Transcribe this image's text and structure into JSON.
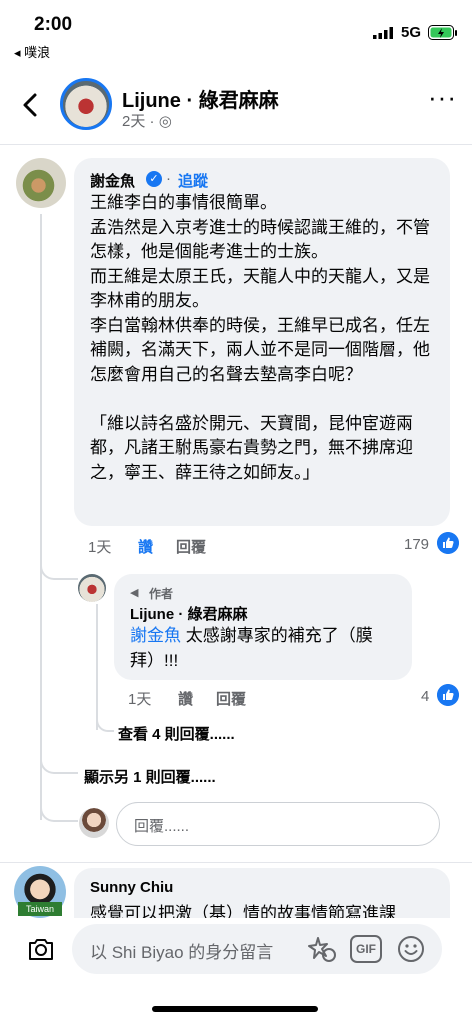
{
  "status_bar": {
    "time": "2:00",
    "back_app": "◂ 噗浪",
    "network": "5G",
    "battery_color": "#34c759"
  },
  "header": {
    "title": "Lijune · 綠君麻麻",
    "meta": "2天 · ",
    "back_icon": "chevron-left-icon",
    "more_icon": "more-horizontal-icon"
  },
  "comment1": {
    "name": "謝金魚",
    "follow": "追蹤",
    "dot": "·",
    "text": "王維李白的事情很簡單。\n孟浩然是入京考進士的時候認識王維的，不管怎樣，他是個能考進士的士族。\n而王維是太原王氏，天龍人中的天龍人，又是李林甫的朋友。\n李白當翰林供奉的時侯，王維早已成名，任左補闕，名滿天下，兩人並不是同一個階層，他怎麼會用自己的名聲去墊高李白呢？\n\n「維以詩名盛於開元、天寶間，昆仲宦遊兩都，凡諸王駙馬豪右貴勢之門，無不拂席迎之，寧王、薛王待之如師友。」",
    "time": "1天",
    "like": "讚",
    "reply": "回覆",
    "like_count": "179"
  },
  "reply1": {
    "author_label": "作者",
    "name": "Lijune · 綠君麻麻",
    "mention": "謝金魚",
    "text": " 太感謝專家的補充了（膜拜）!!!",
    "time": "1天",
    "like": "讚",
    "reply": "回覆",
    "like_count": "4"
  },
  "thread": {
    "view_more": "查看 4 則回覆......",
    "show_more": "顯示另 1 則回覆......",
    "reply_placeholder": "回覆......"
  },
  "comment2": {
    "name": "Sunny Chiu",
    "badge": "Taiwan",
    "text": "感覺可以把激（基）情的故事情節寫進課"
  },
  "composer": {
    "placeholder": "以 Shi Biyao 的身分留言",
    "gif_label": "GIF"
  },
  "colors": {
    "accent": "#1877f2",
    "bubble": "#f0f2f5",
    "secondary_text": "#65676b"
  }
}
